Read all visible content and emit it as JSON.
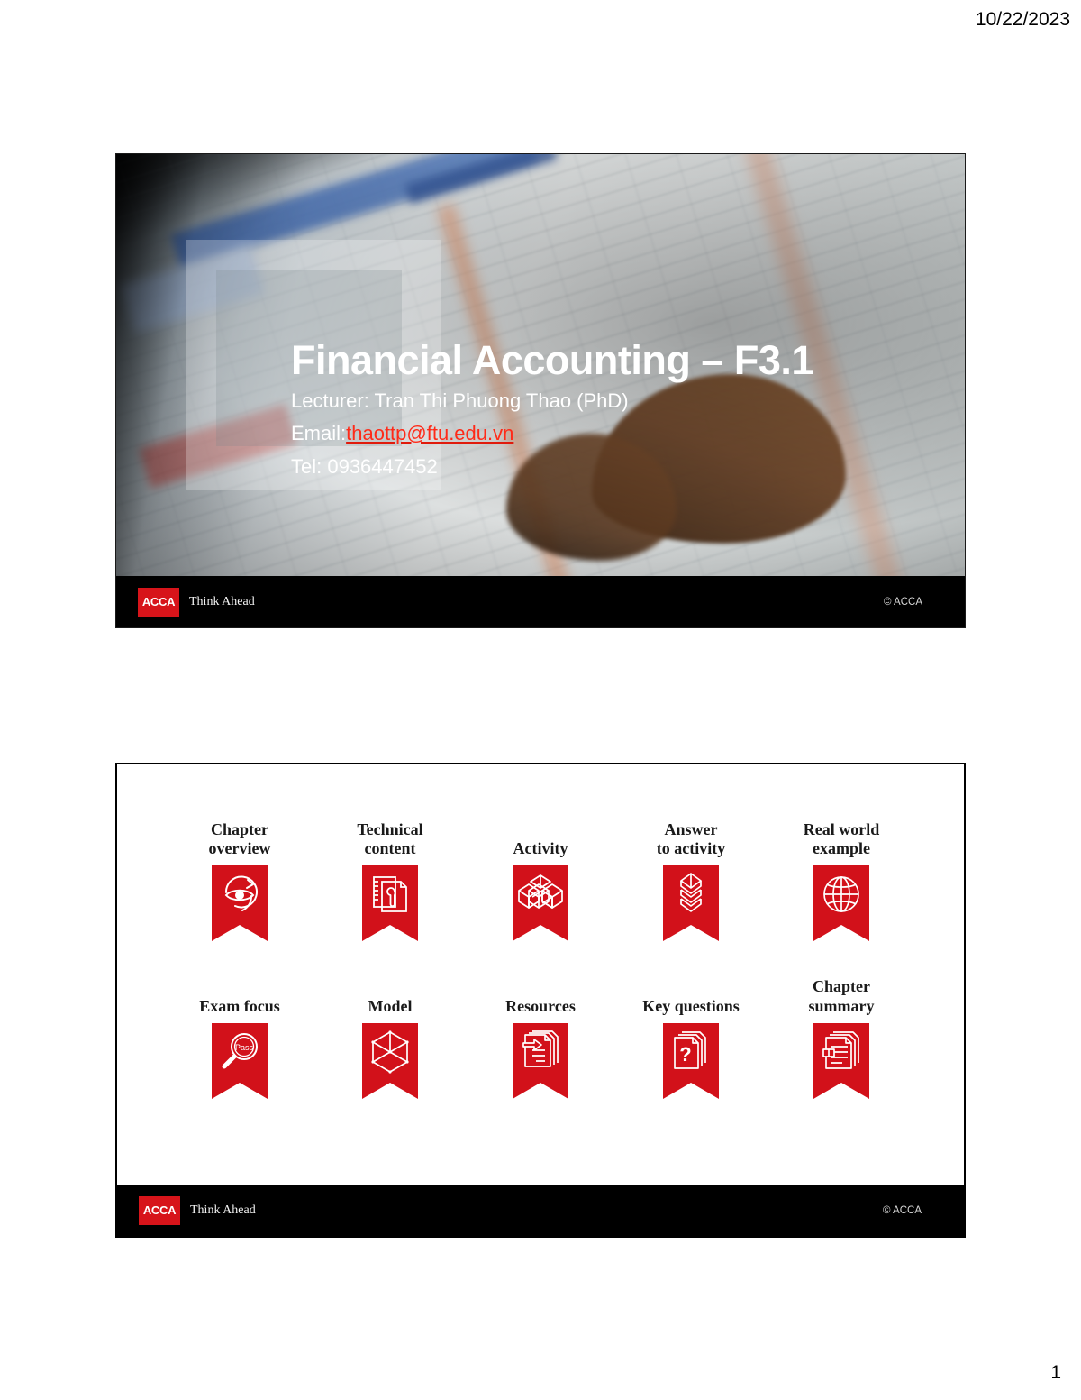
{
  "page": {
    "date": "10/22/2023",
    "number": "1"
  },
  "slide1": {
    "title": "Financial Accounting – F3.1",
    "lecturer": "Lecturer: Tran Thi Phuong Thao (PhD)",
    "email_label": "Email:",
    "email": "thaottp@ftu.edu.vn",
    "tel": "Tel: 0936447452",
    "footer": {
      "logo_text": "ACCA",
      "tagline": "Think Ahead",
      "copyright": "© ACCA"
    },
    "colors": {
      "acca_red": "#d7141a",
      "link_red": "#ff2a18",
      "footer_bg": "#000000"
    }
  },
  "slide2": {
    "icons_row1": [
      {
        "label": "Chapter\noverview",
        "icon": "eye-refresh-icon"
      },
      {
        "label": "Technical\ncontent",
        "icon": "document-wrench-icon"
      },
      {
        "label": "Activity",
        "icon": "three-cubes-icon"
      },
      {
        "label": "Answer\nto activity",
        "icon": "stacked-cubes-icon"
      },
      {
        "label": "Real world\nexample",
        "icon": "globe-icon"
      }
    ],
    "icons_row2": [
      {
        "label": "Exam focus",
        "icon": "magnifier-pass-icon",
        "badge_text": "Pass"
      },
      {
        "label": "Model",
        "icon": "wireframe-cube-icon"
      },
      {
        "label": "Resources",
        "icon": "document-arrow-icon"
      },
      {
        "label": "Key questions",
        "icon": "document-question-icon",
        "badge_text": "?"
      },
      {
        "label": "Chapter\nsummary",
        "icon": "document-summary-icon"
      }
    ],
    "footer": {
      "logo_text": "ACCA",
      "tagline": "Think Ahead",
      "copyright": "© ACCA"
    },
    "colors": {
      "ribbon_red": "#d2111a",
      "border": "#000000"
    }
  }
}
